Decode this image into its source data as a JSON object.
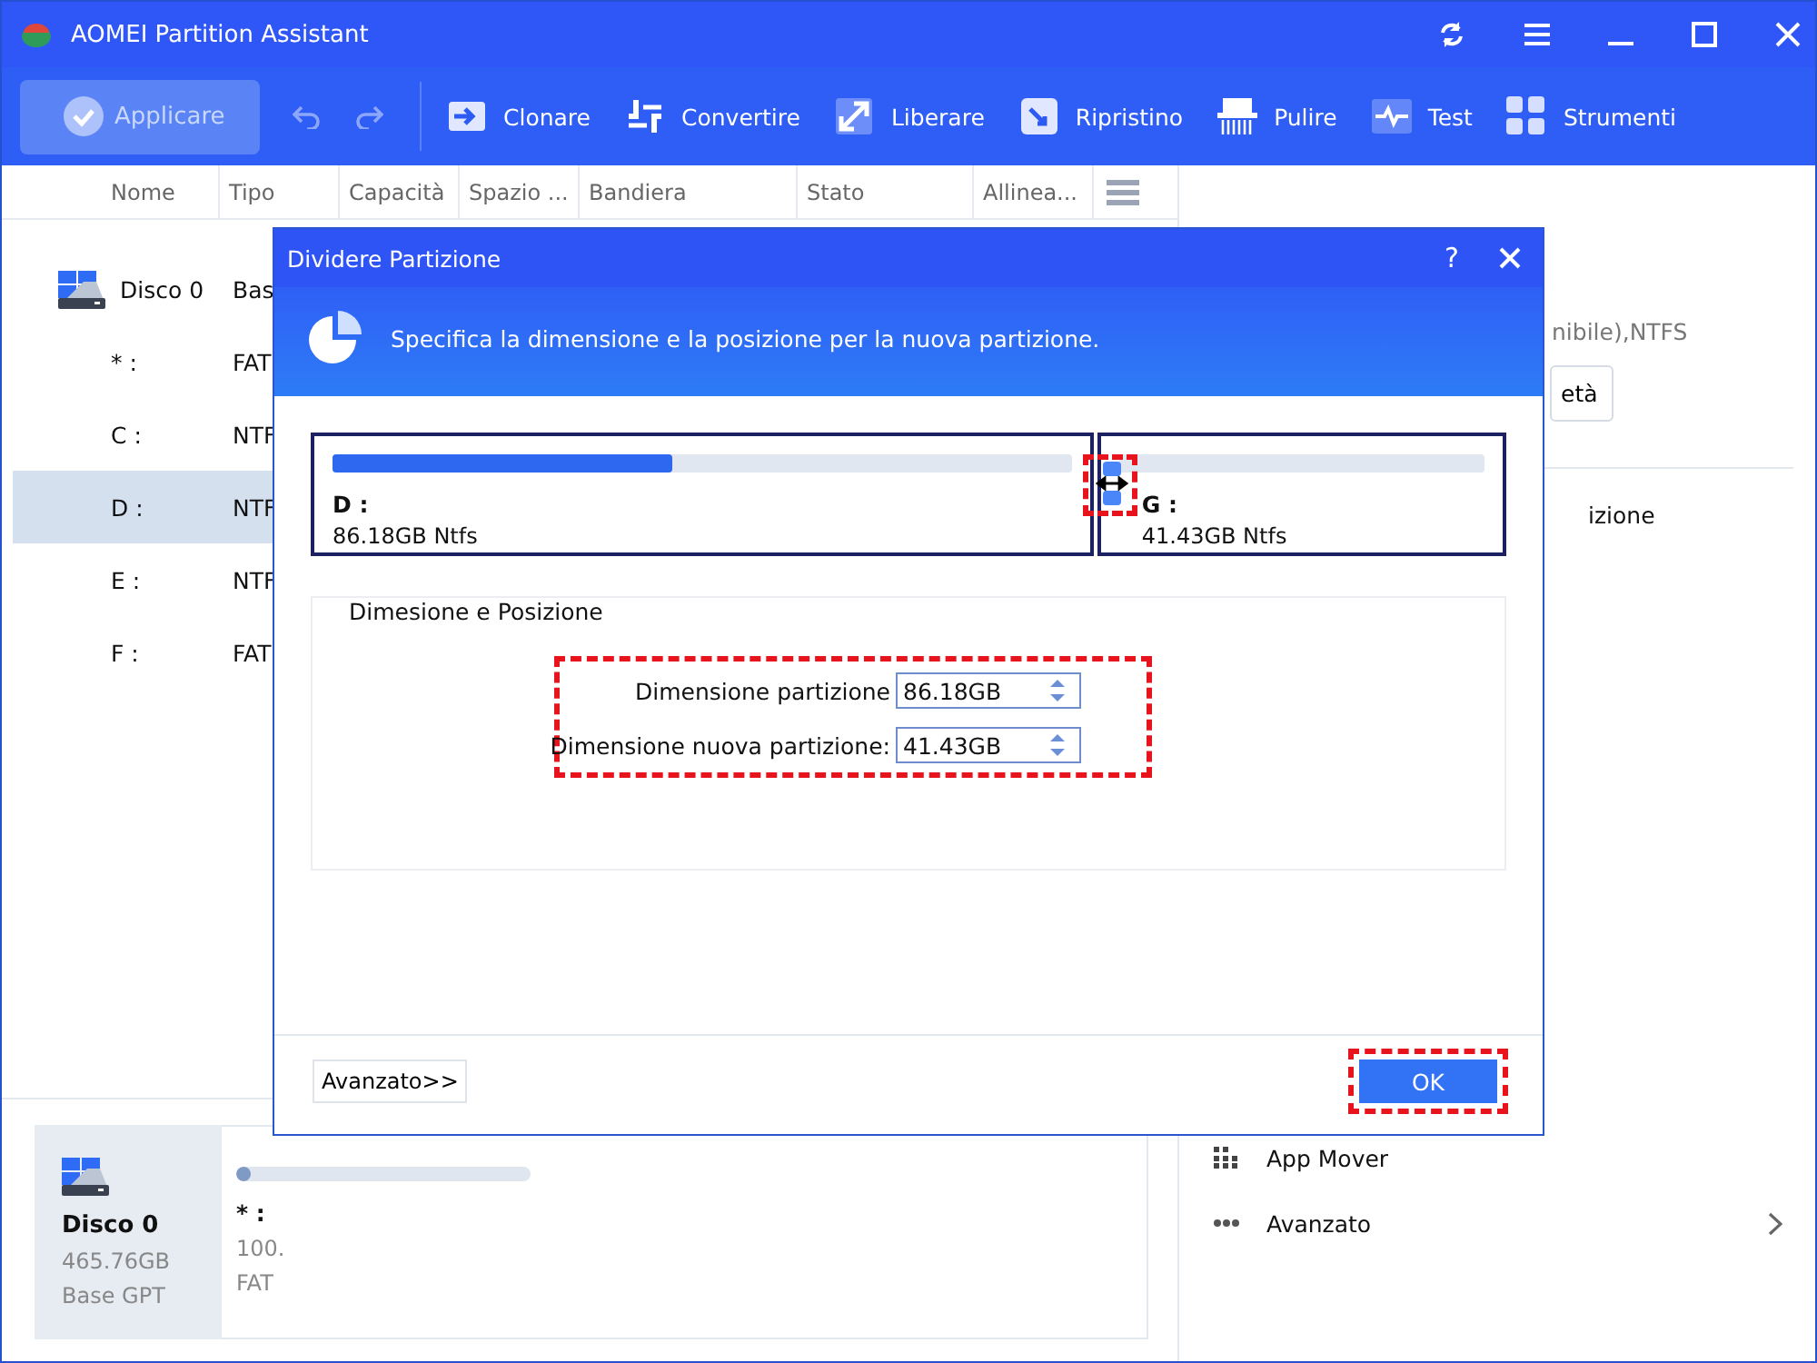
{
  "window": {
    "title": "AOMEI Partition Assistant"
  },
  "toolbar": {
    "apply": {
      "label": "Applicare",
      "disabled": true
    },
    "undo_disabled": true,
    "items": [
      {
        "label": "Clonare",
        "kind": "clone"
      },
      {
        "label": "Convertire",
        "kind": "convert"
      },
      {
        "label": "Liberare",
        "kind": "free"
      },
      {
        "label": "Ripristino",
        "kind": "restore"
      },
      {
        "label": "Pulire",
        "kind": "wipe"
      },
      {
        "label": "Test",
        "kind": "test"
      },
      {
        "label": "Strumenti",
        "kind": "tools"
      }
    ]
  },
  "table": {
    "columns": [
      "Nome",
      "Tipo",
      "Capacità",
      "Spazio ...",
      "Bandiera",
      "Stato",
      "Allinea..."
    ],
    "rows": [
      {
        "name": "Disco 0",
        "type": "Bas",
        "kind": "disk",
        "selected": false
      },
      {
        "name": "* :",
        "type": "FAT",
        "kind": "partition",
        "selected": false
      },
      {
        "name": "C :",
        "type": "NTF",
        "kind": "partition",
        "selected": false
      },
      {
        "name": "D :",
        "type": "NTF",
        "kind": "partition",
        "selected": true
      },
      {
        "name": "E :",
        "type": "NTF",
        "kind": "partition",
        "selected": false
      },
      {
        "name": "F :",
        "type": "FAT",
        "kind": "partition",
        "selected": false
      }
    ]
  },
  "disk_map": {
    "disk": {
      "name": "Disco 0",
      "size": "465.76GB",
      "style": "Base GPT"
    },
    "partitions": [
      {
        "label": "* :",
        "size": "100.",
        "fs": "FAT",
        "level": 0.05
      }
    ]
  },
  "right_panel": {
    "info": "nibile),NTFS",
    "button": "età",
    "items": [
      {
        "label": "izione",
        "kind": "plain"
      },
      {
        "label": "App Mover",
        "kind": "grid"
      },
      {
        "label": "Avanzato",
        "kind": "more"
      }
    ]
  },
  "dialog": {
    "title": "Dividere Partizione",
    "help": "?",
    "header": "Specifica la dimensione e la posizione per la nuova partizione.",
    "split": {
      "level": 0.67,
      "highlighted": true
    },
    "partitions": [
      {
        "letter": "D :",
        "info": "86.18GB Ntfs",
        "level": 0.46
      },
      {
        "letter": "G :",
        "info": "41.43GB Ntfs",
        "level": 0
      }
    ],
    "group": {
      "legend": "Dimesione e Posizione",
      "highlighted": true,
      "fields": [
        {
          "label": "Dimensione partizione",
          "value": "86.18GB"
        },
        {
          "label": "Dimensione nuova partizione:",
          "value": "41.43GB"
        }
      ]
    },
    "advanced": "Avanzato>>",
    "ok": {
      "label": "OK",
      "highlighted": true
    }
  }
}
